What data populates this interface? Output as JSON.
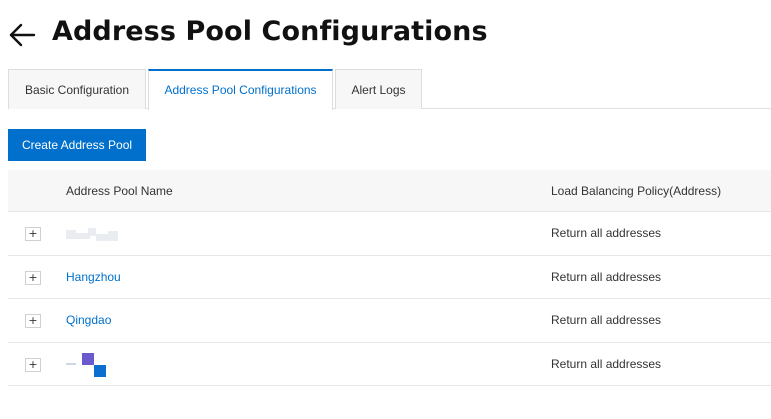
{
  "header": {
    "title": "Address Pool Configurations",
    "back_icon": "arrow-left-icon"
  },
  "tabs": [
    {
      "label": "Basic Configuration",
      "active": false
    },
    {
      "label": "Address Pool Configurations",
      "active": true
    },
    {
      "label": "Alert Logs",
      "active": false
    }
  ],
  "toolbar": {
    "create_label": "Create Address Pool"
  },
  "table": {
    "columns": [
      "Address Pool Name",
      "Load Balancing Policy(Address)"
    ],
    "expand_symbol": "+",
    "rows": [
      {
        "name": "",
        "name_obscured": true,
        "policy": "Return all addresses"
      },
      {
        "name": "Hangzhou",
        "policy": "Return all addresses"
      },
      {
        "name": "Qingdao",
        "policy": "Return all addresses"
      },
      {
        "name": "",
        "name_obscured": true,
        "policy": "Return all addresses"
      }
    ]
  },
  "colors": {
    "accent": "#0070cc",
    "redaction_purple": "#6a5acd",
    "redaction_blue": "#0a6fd0"
  }
}
